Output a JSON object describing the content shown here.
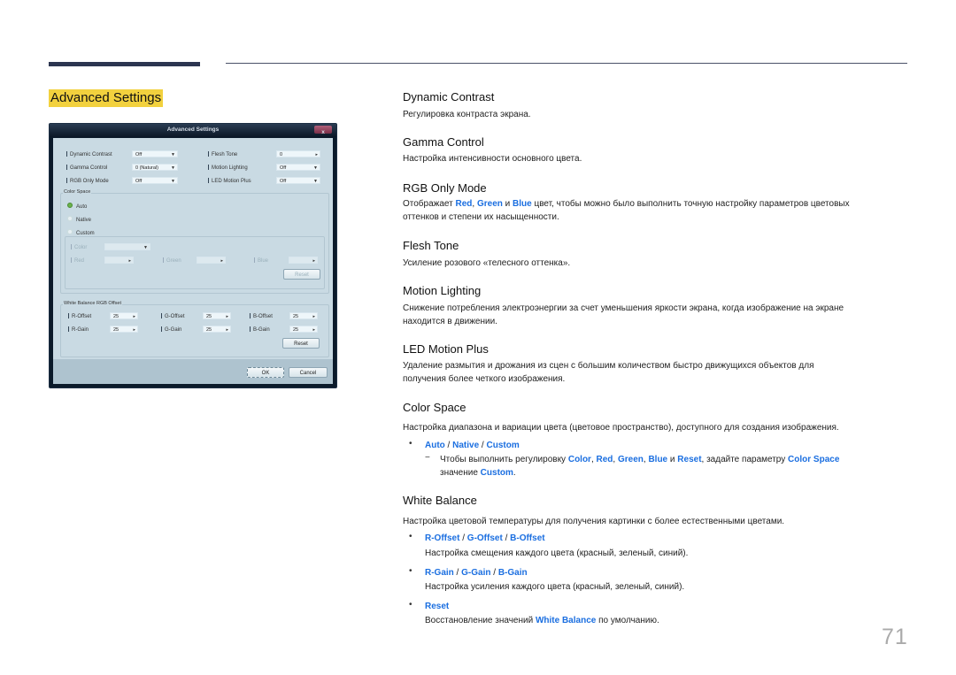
{
  "page": {
    "section_title": "Advanced Settings",
    "page_number": "71"
  },
  "dialog": {
    "title": "Advanced Settings",
    "close_label": "x",
    "left_fields": [
      {
        "label": "Dynamic Contrast",
        "value": "Off",
        "control": "dropdown"
      },
      {
        "label": "Gamma Control",
        "value": "0 (Natural)",
        "control": "dropdown"
      },
      {
        "label": "RGB Only Mode",
        "value": "Off",
        "control": "dropdown"
      }
    ],
    "right_fields": [
      {
        "label": "Flesh Tone",
        "value": "0",
        "control": "stepper"
      },
      {
        "label": "Motion Lighting",
        "value": "Off",
        "control": "dropdown"
      },
      {
        "label": "LED Motion Plus",
        "value": "Off",
        "control": "dropdown"
      }
    ],
    "color_space": {
      "group_label": "Color Space",
      "options": [
        "Auto",
        "Native",
        "Custom"
      ],
      "selected": "Auto",
      "custom": {
        "color_label": "Color",
        "color_value": "",
        "red_label": "Red",
        "green_label": "Green",
        "blue_label": "Blue",
        "reset_label": "Reset"
      }
    },
    "white_balance": {
      "group_label": "White Balance RGB Offset",
      "rows": [
        [
          {
            "label": "R-Offset",
            "value": "25"
          },
          {
            "label": "G-Offset",
            "value": "25"
          },
          {
            "label": "B-Offset",
            "value": "25"
          }
        ],
        [
          {
            "label": "R-Gain",
            "value": "25"
          },
          {
            "label": "G-Gain",
            "value": "25"
          },
          {
            "label": "B-Gain",
            "value": "25"
          }
        ]
      ],
      "reset_label": "Reset"
    },
    "ok_label": "OK",
    "cancel_label": "Cancel",
    "icons": {
      "dropdown": "▼",
      "stepper": "▸"
    }
  },
  "content": {
    "dynamic_contrast": {
      "title": "Dynamic Contrast",
      "desc": "Регулировка контраста экрана."
    },
    "gamma_control": {
      "title": "Gamma Control",
      "desc": "Настройка интенсивности основного цвета."
    },
    "rgb_only_mode": {
      "title": "RGB Only Mode",
      "desc_pre": "Отображает ",
      "red": "Red",
      "comma": ", ",
      "green": "Green",
      "and": " и ",
      "blue": "Blue",
      "desc_post": " цвет, чтобы можно было выполнить точную настройку параметров цветовых",
      "desc_line2": "оттенков и степени их насыщенности."
    },
    "flesh_tone": {
      "title": "Flesh Tone",
      "desc": "Усиление розового «телесного оттенка»."
    },
    "motion_lighting": {
      "title": "Motion Lighting",
      "desc_line1": "Снижение потребления электроэнергии за счет уменьшения яркости экрана, когда изображение на экране",
      "desc_line2": "находится в движении."
    },
    "led_motion_plus": {
      "title": "LED Motion Plus",
      "desc_line1": "Удаление размытия и дрожания из сцен с большим количеством быстро движущихся объектов для",
      "desc_line2": "получения более четкого изображения."
    },
    "color_space": {
      "title": "Color Space",
      "desc": "Настройка диапазона и вариации цвета (цветовое пространство), доступного для создания изображения.",
      "bullet": "•",
      "opt_auto": "Auto",
      "sep": " / ",
      "opt_native": "Native",
      "opt_custom": "Custom",
      "dash": "−",
      "note_pre": "Чтобы выполнить регулировку ",
      "note_color": "Color",
      "note_comma": ", ",
      "note_red": "Red",
      "note_green": "Green",
      "note_blue": "Blue",
      "note_and": " и ",
      "note_reset": "Reset",
      "note_mid": ", задайте параметру ",
      "note_cs": "Color Space",
      "note_line2_pre": "значение ",
      "note_custom": "Custom",
      "note_end": "."
    },
    "white_balance": {
      "title": "White Balance",
      "desc": "Настройка цветовой температуры для получения картинки с более естественными цветами.",
      "bullet": "•",
      "offset_r": "R-Offset",
      "offset_g": "G-Offset",
      "offset_b": "B-Offset",
      "sep": " / ",
      "offset_desc": "Настройка смещения каждого цвета (красный, зеленый, синий).",
      "gain_r": "R-Gain",
      "gain_g": "G-Gain",
      "gain_b": "B-Gain",
      "gain_desc": "Настройка усиления каждого цвета (красный, зеленый, синий).",
      "reset": "Reset",
      "reset_desc_pre": "Восстановление значений ",
      "reset_wb": "White Balance",
      "reset_desc_post": " по умолчанию."
    }
  },
  "colors": {
    "accent_blue": "#1a6ee0",
    "title_highlight": "#f2d13e",
    "rule": "#2c3550"
  }
}
